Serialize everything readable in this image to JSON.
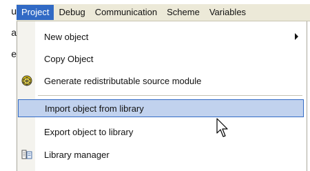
{
  "left_fragment": [
    "u",
    "a",
    "e"
  ],
  "menubar": {
    "items": [
      {
        "label": "Project",
        "active": true
      },
      {
        "label": "Debug"
      },
      {
        "label": "Communication"
      },
      {
        "label": "Scheme"
      },
      {
        "label": "Variables"
      }
    ]
  },
  "project_menu": {
    "items": [
      {
        "label": "New object",
        "has_submenu": true
      },
      {
        "label": "Copy Object"
      },
      {
        "label": "Generate redistributable source module",
        "icon": "module-icon"
      },
      {
        "label": "Import object from library",
        "highlighted": true
      },
      {
        "label": "Export object to library"
      },
      {
        "label": "Library manager",
        "icon": "library-manager-icon"
      }
    ]
  },
  "colors": {
    "menu_active": "#316ac5",
    "highlight_fill": "#c1d2ee",
    "menubar_bg": "#ece9d8"
  }
}
